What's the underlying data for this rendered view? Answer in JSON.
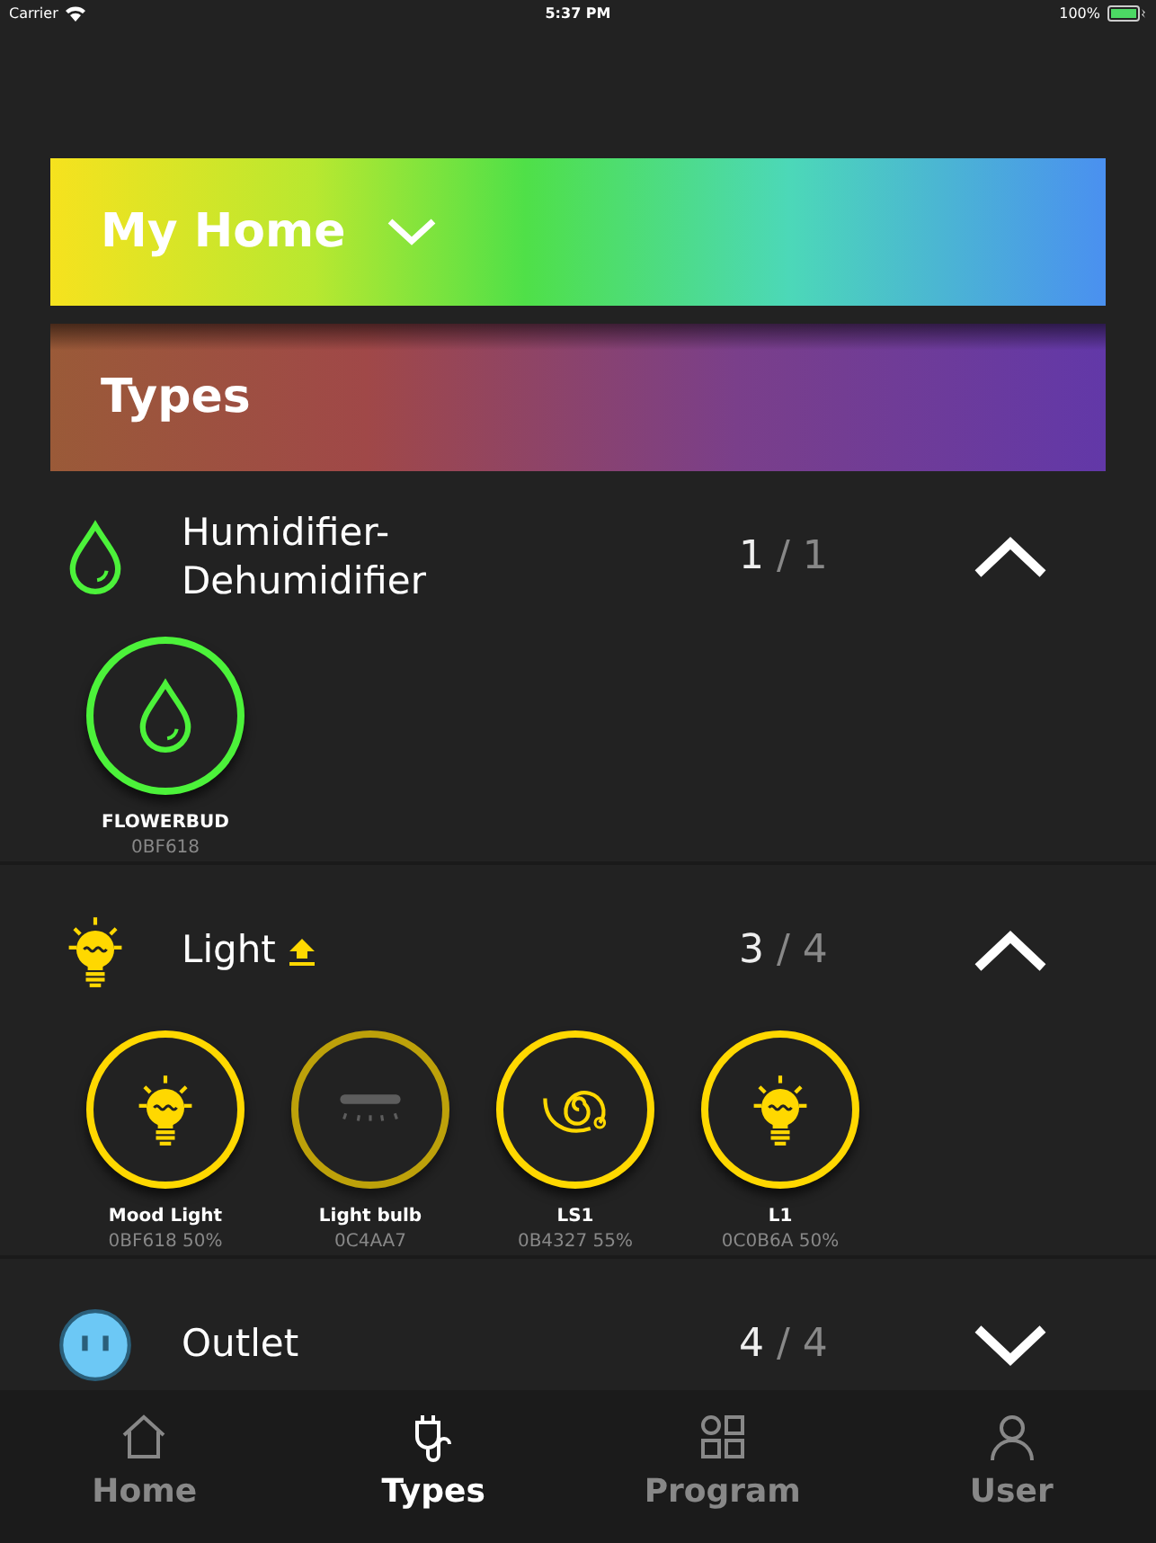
{
  "status_bar": {
    "carrier": "Carrier",
    "time": "5:37 PM",
    "battery": "100%"
  },
  "home_selector": {
    "title": "My Home",
    "expanded": false
  },
  "section_title": "Types",
  "categories": [
    {
      "kind": "humidifier",
      "name": "Humidifier-\nDehumidifier",
      "color": "#4cf23a",
      "count": "1",
      "total": "/ 1",
      "update_available": false,
      "expanded": true,
      "devices": [
        {
          "kind": "drop",
          "name": "FLOWERBUD",
          "detail": "0BF618",
          "on": true
        }
      ]
    },
    {
      "kind": "light",
      "name": "Light",
      "color": "#ffd800",
      "count": "3",
      "total": "/ 4",
      "update_available": true,
      "expanded": true,
      "devices": [
        {
          "kind": "bulb",
          "name": "Mood Light",
          "detail": "0BF618 50%",
          "on": true
        },
        {
          "kind": "ceiling",
          "name": "Light bulb",
          "detail": "0C4AA7",
          "on": false
        },
        {
          "kind": "strip",
          "name": "LS1",
          "detail": "0B4327 55%",
          "on": true
        },
        {
          "kind": "bulb",
          "name": "L1",
          "detail": "0C0B6A 50%",
          "on": true
        }
      ]
    },
    {
      "kind": "outlet",
      "name": "Outlet",
      "color": "#6cc8f5",
      "count": "4",
      "total": "/ 4",
      "update_available": false,
      "expanded": false
    }
  ],
  "tab_bar": [
    {
      "kind": "home",
      "label": "Home",
      "selected": false
    },
    {
      "kind": "types",
      "label": "Types",
      "selected": true
    },
    {
      "kind": "program",
      "label": "Program",
      "selected": false
    },
    {
      "kind": "user",
      "label": "User",
      "selected": false
    }
  ]
}
